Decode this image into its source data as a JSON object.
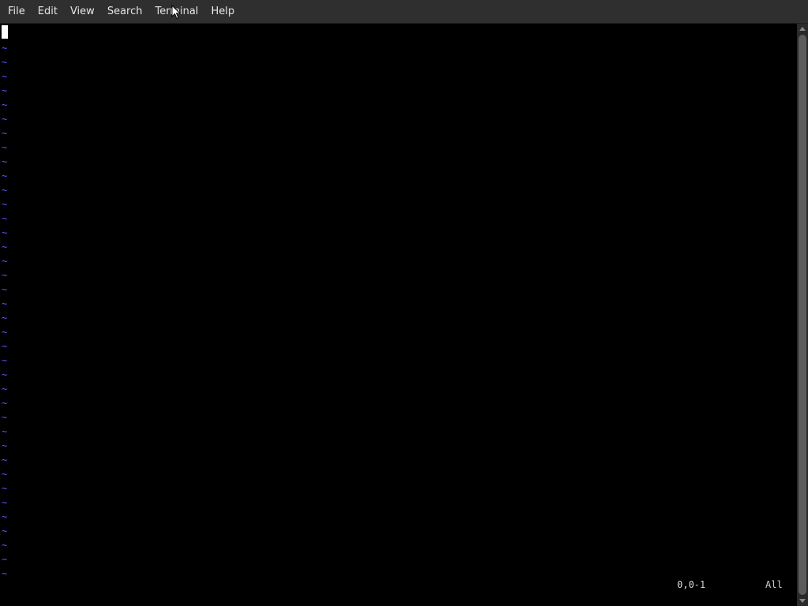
{
  "menubar": {
    "items": [
      "File",
      "Edit",
      "View",
      "Search",
      "Terminal",
      "Help"
    ]
  },
  "editor": {
    "empty_line_marker": "~",
    "empty_line_count": 38
  },
  "statusline": {
    "position": "0,0-1",
    "scroll": "All"
  },
  "colors": {
    "menubar_bg": "#2f2f2f",
    "terminal_bg": "#000000",
    "tilde": "#5a5aff",
    "cursor": "#ffffff"
  }
}
